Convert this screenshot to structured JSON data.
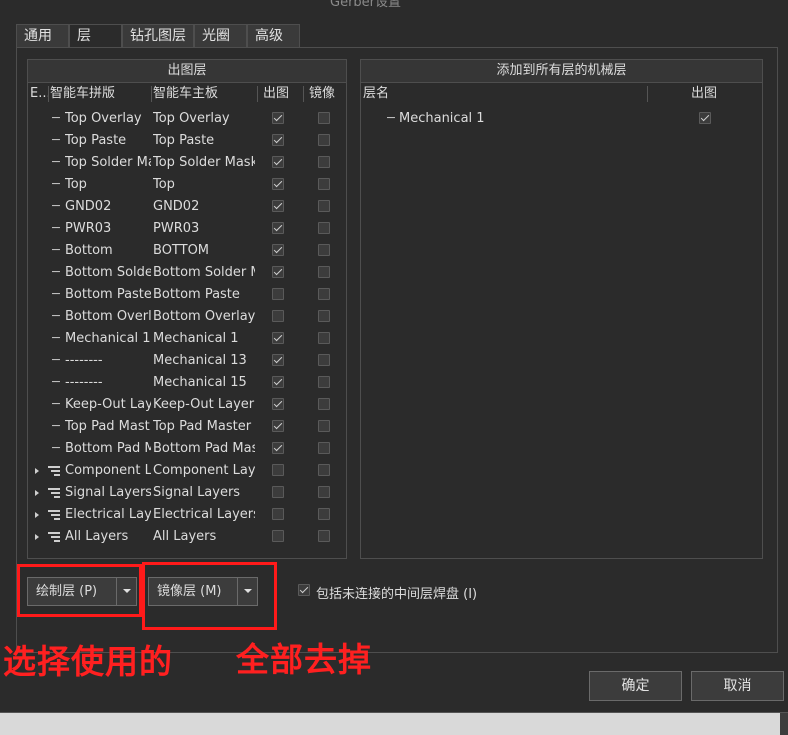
{
  "window": {
    "title": "Gerber设置"
  },
  "tabs": [
    {
      "label": "通用"
    },
    {
      "label": "层"
    },
    {
      "label": "钻孔图层"
    },
    {
      "label": "光圈"
    },
    {
      "label": "高级"
    }
  ],
  "left_group": {
    "title": "出图层",
    "columns": {
      "e": "E...",
      "panel": "智能车拼版",
      "main": "智能车主板",
      "plot": "出图",
      "mirror": "镜像"
    },
    "rows": [
      {
        "panel": "Top Overlay",
        "main": "Top Overlay",
        "plot": true,
        "mirror": false
      },
      {
        "panel": "Top Paste",
        "main": "Top Paste",
        "plot": true,
        "mirror": false
      },
      {
        "panel": "Top Solder Ma",
        "main": "Top Solder Mask",
        "plot": true,
        "mirror": false
      },
      {
        "panel": "Top",
        "main": "Top",
        "plot": true,
        "mirror": false
      },
      {
        "panel": "GND02",
        "main": "GND02",
        "plot": true,
        "mirror": false
      },
      {
        "panel": "PWR03",
        "main": "PWR03",
        "plot": true,
        "mirror": false
      },
      {
        "panel": "Bottom",
        "main": "BOTTOM",
        "plot": true,
        "mirror": false
      },
      {
        "panel": "Bottom Solder",
        "main": "Bottom Solder M",
        "plot": true,
        "mirror": false
      },
      {
        "panel": "Bottom Paste",
        "main": "Bottom Paste",
        "plot": false,
        "mirror": false
      },
      {
        "panel": "Bottom Overla",
        "main": "Bottom Overlay",
        "plot": false,
        "mirror": false
      },
      {
        "panel": "Mechanical 1",
        "main": "Mechanical 1",
        "plot": true,
        "mirror": false
      },
      {
        "panel": "--------",
        "main": "Mechanical 13",
        "plot": true,
        "mirror": false
      },
      {
        "panel": "--------",
        "main": "Mechanical 15",
        "plot": true,
        "mirror": false
      },
      {
        "panel": "Keep-Out Lay",
        "main": "Keep-Out Layer",
        "plot": true,
        "mirror": false
      },
      {
        "panel": "Top Pad Mast",
        "main": "Top Pad Master",
        "plot": true,
        "mirror": false
      },
      {
        "panel": "Bottom Pad M",
        "main": "Bottom Pad Mas",
        "plot": true,
        "mirror": false
      }
    ],
    "group_rows": [
      {
        "panel": "Component L",
        "main": "Component Laye",
        "plot": false,
        "mirror": false
      },
      {
        "panel": "Signal Layers",
        "main": "Signal Layers",
        "plot": false,
        "mirror": false
      },
      {
        "panel": "Electrical Laye",
        "main": "Electrical Layers",
        "plot": false,
        "mirror": false
      },
      {
        "panel": "All Layers",
        "main": "All Layers",
        "plot": false,
        "mirror": false
      }
    ]
  },
  "right_group": {
    "title": "添加到所有层的机械层",
    "columns": {
      "name": "层名",
      "plot": "出图"
    },
    "rows": [
      {
        "name": "Mechanical 1",
        "plot": true
      }
    ]
  },
  "buttons": {
    "plot_layers": "绘制层 (P)",
    "mirror_layers": "镜像层 (M)",
    "include_unconnected": "包括未连接的中间层焊盘 (I)",
    "include_unconnected_checked": true,
    "ok": "确定",
    "cancel": "取消"
  },
  "annotations": {
    "left": "选择使用的",
    "right": "全部去掉",
    "color": "#ff2020"
  }
}
